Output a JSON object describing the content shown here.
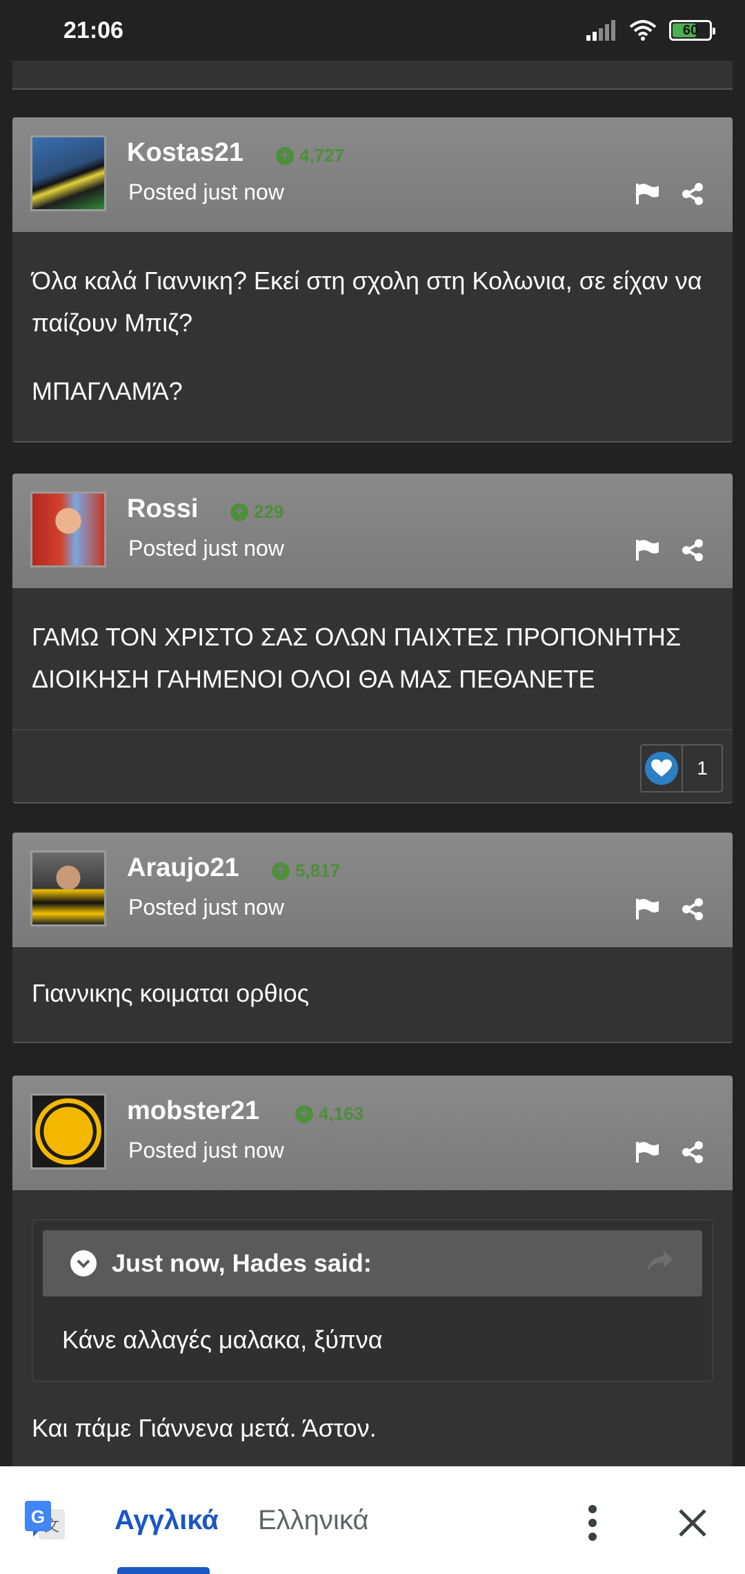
{
  "status_bar": {
    "time": "21:06",
    "battery": "60",
    "battery_level": 0.6
  },
  "posts": [
    {
      "username": "Kostas21",
      "reputation": "4,727",
      "posted_prefix": "Posted",
      "posted_time": "just now",
      "paragraphs": [
        "Όλα καλά Γιαννικη? Εκεί στη σχολη στη Κολωνια, σε είχαν να παίζουν Μπιζ?",
        "ΜΠΑΓΛΑΜΆ?"
      ],
      "avatar_icon": "referee-avatar"
    },
    {
      "username": "Rossi",
      "reputation": "229",
      "posted_prefix": "Posted",
      "posted_time": "just now",
      "paragraphs": [
        "ΓΑΜΩ ΤΟΝ ΧΡΙΣΤΟ ΣΑΣ ΟΛΩΝ ΠΑΙΧΤΕΣ ΠΡΟΠΟΝΗΤΗΣ ΔΙΟΙΚΗΣΗ ΓΑΗΜΕΝΟΙ ΟΛΟΙ ΘΑ ΜΑΣ ΠΕΘΑΝΕΤΕ"
      ],
      "reaction_count": "1",
      "avatar_icon": "athlete-avatar"
    },
    {
      "username": "Araujo21",
      "reputation": "5,817",
      "posted_prefix": "Posted",
      "posted_time": "just now",
      "paragraphs": [
        "Γιαννικης κοιμαται ορθιος"
      ],
      "avatar_icon": "player-avatar"
    },
    {
      "username": "mobster21",
      "reputation": "4,163",
      "posted_prefix": "Posted",
      "posted_time": "just now",
      "quote": {
        "title": "Just now, Hades said:",
        "text": "Κάνε αλλαγές μαλακα, ξύπνα"
      },
      "paragraphs": [
        "Και πάμε Γιάννενα μετά. Άστον."
      ],
      "avatar_icon": "eagle-crest-avatar"
    }
  ],
  "translate_bar": {
    "active_language": "Αγγλικά",
    "other_language": "Ελληνικά",
    "accent_color": "#1a56c4"
  }
}
